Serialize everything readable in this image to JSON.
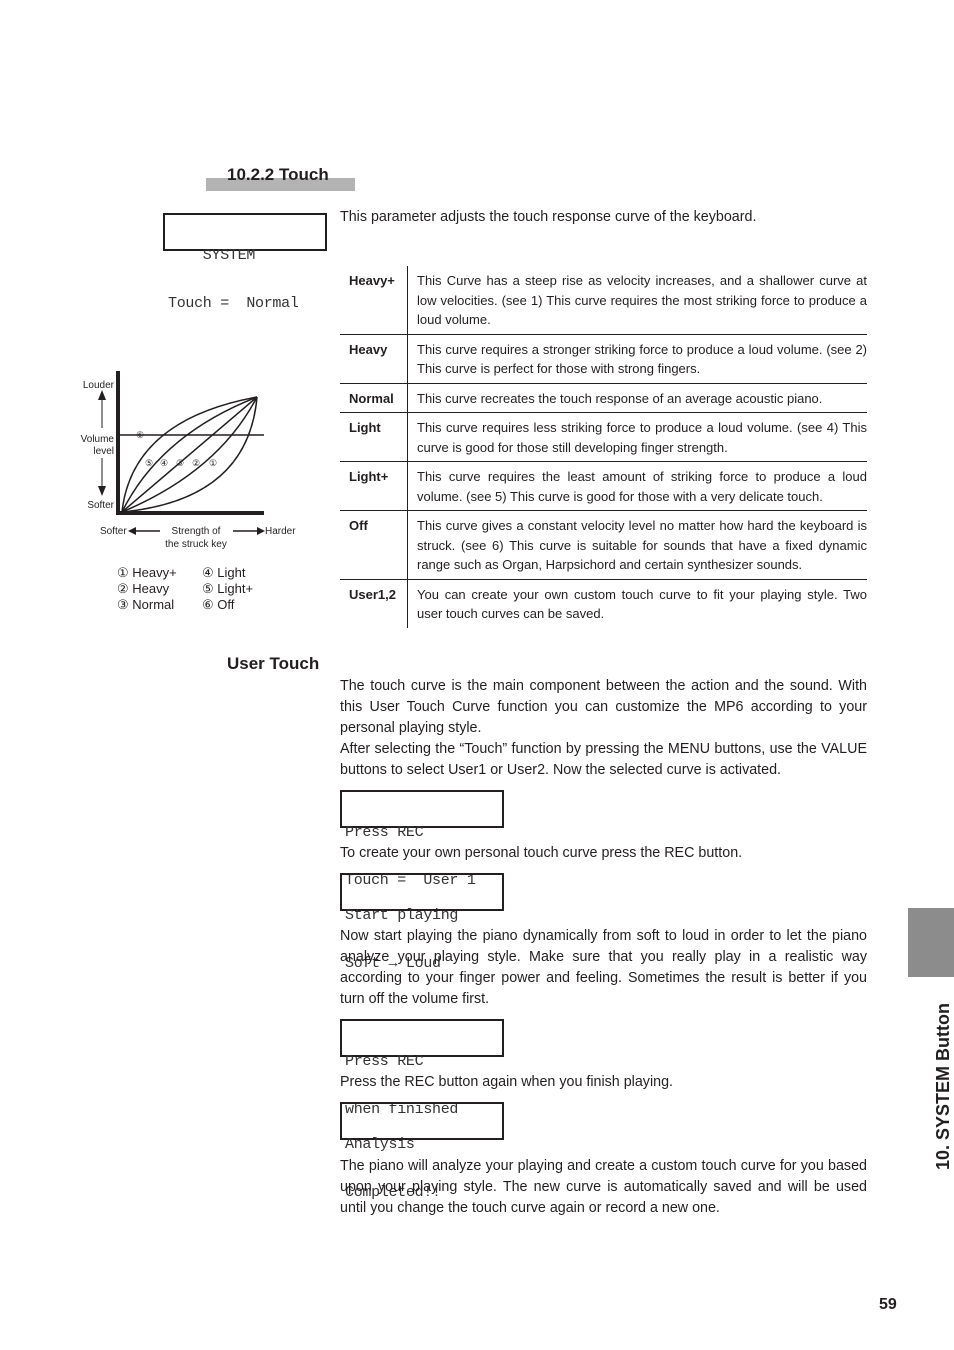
{
  "section": {
    "title": "10.2.2 Touch",
    "intro": "This parameter adjusts the touch response curve of the keyboard."
  },
  "lcd_system": {
    "line1": "    SYSTEM",
    "line2": "Touch =  Normal"
  },
  "table": [
    {
      "key": "Heavy+",
      "desc": "This Curve has a steep rise as velocity increases, and a shallower curve at low velocities. (see 1) This curve requires the most striking force to produce a loud volume."
    },
    {
      "key": "Heavy",
      "desc": "This curve requires a stronger striking force to produce a loud volume. (see 2) This curve is perfect for those with strong fingers."
    },
    {
      "key": "Normal",
      "desc": "This curve recreates the touch response of an average acoustic piano."
    },
    {
      "key": "Light",
      "desc": "This curve requires less striking force to produce a loud volume. (see 4) This curve is good for those still developing finger strength."
    },
    {
      "key": "Light+",
      "desc": "This curve requires the least amount of striking force to produce a loud volume. (see 5) This curve is good for those with a very delicate touch."
    },
    {
      "key": "Off",
      "desc": "This curve gives a constant velocity level no matter how hard the keyboard is struck. (see 6) This curve is suitable for sounds that have a fixed dynamic range such as Organ, Harpsichord and certain synthesizer sounds."
    },
    {
      "key": "User1,2",
      "desc": "You can create your own custom touch curve to fit your playing style. Two user touch curves can be saved."
    }
  ],
  "diagram": {
    "louder": "Louder",
    "volume": "Volume",
    "level": "level",
    "softer_y": "Softer",
    "softer_x": "Softer",
    "strength1": "Strength of",
    "strength2": "the struck key",
    "harder": "Harder",
    "marks": [
      "⑤",
      "④",
      "③",
      "②",
      "①"
    ],
    "off_mark": "⑥",
    "legend": [
      "① Heavy+",
      "② Heavy",
      "③ Normal",
      "④ Light",
      "⑤ Light+",
      "⑥ Off"
    ]
  },
  "user_touch": {
    "title": "User Touch",
    "p1": "The touch curve is the main component between the action and the sound. With this User Touch Curve function you can customize the MP6 according to your personal playing style.",
    "p2": "After selecting the “Touch” function by pressing the MENU buttons, use the VALUE buttons to select User1 or User2. Now the selected curve is activated.",
    "lcd1": {
      "line1": "Press REC",
      "line2": "Touch =  User 1"
    },
    "p3": "To create your own personal touch curve press the REC button.",
    "lcd2": {
      "line1": "Start playing",
      "line2": "Soft → Loud"
    },
    "p4": "Now start playing the piano dynamically from soft to loud in order to let the piano analyze your playing style. Make sure that you really play in a realistic way according to your finger power and feeling. Sometimes the result is better if you turn off the volume first.",
    "lcd3": {
      "line1": "Press REC",
      "line2": "when finished"
    },
    "p5": "Press the REC button again when you finish playing.",
    "lcd4": {
      "line1": "Analysis",
      "line2": "Completed!!"
    },
    "p6": "The piano will analyze your playing and create a custom touch curve for you based upon your playing style. The new curve is automatically saved and will be used until you change the touch curve again or record a new one."
  },
  "side_tab": "10. SYSTEM Button",
  "page_number": "59"
}
